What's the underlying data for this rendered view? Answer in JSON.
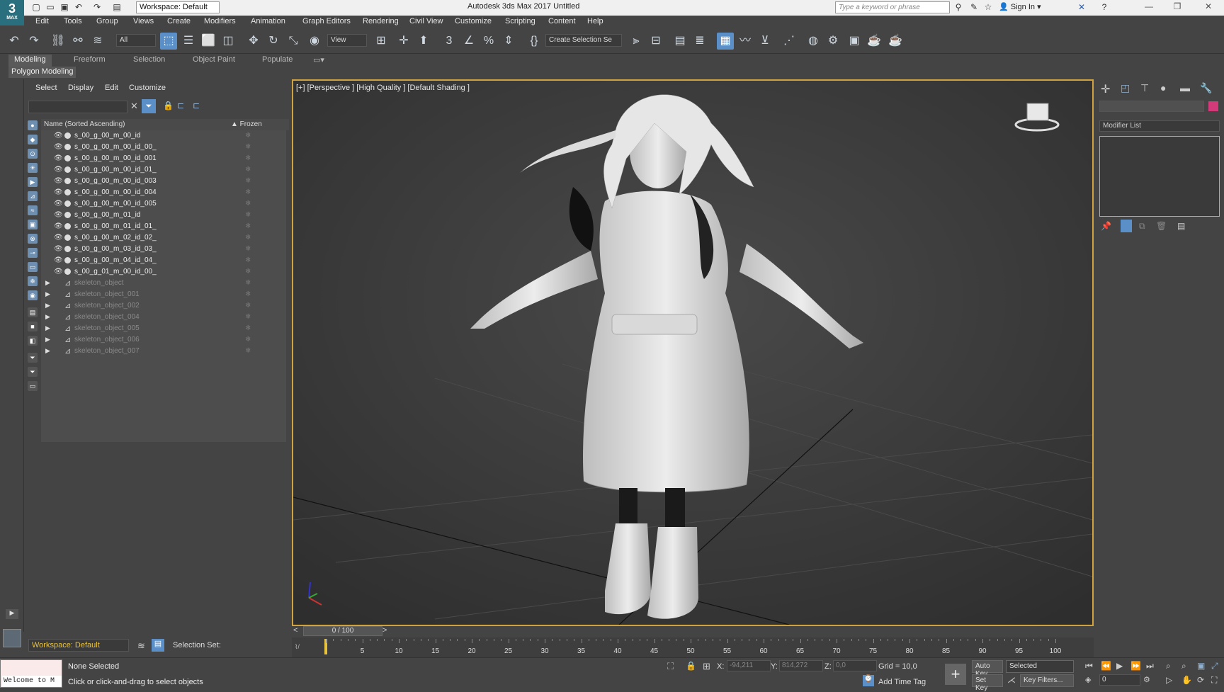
{
  "titlebar": {
    "logo_text": "3",
    "logo_sub": "MAX",
    "workspace": "Workspace: Default",
    "app_title": "Autodesk 3ds Max 2017     Untitled",
    "search_placeholder": "Type a keyword or phrase",
    "signin": "Sign In"
  },
  "menu": [
    "Edit",
    "Tools",
    "Group",
    "Views",
    "Create",
    "Modifiers",
    "Animation",
    "Graph Editors",
    "Rendering",
    "Civil View",
    "Customize",
    "Scripting",
    "Content",
    "Help"
  ],
  "toolbar": {
    "filter_value": "All",
    "refcoord_value": "View",
    "selection_set_value": "Create Selection Se"
  },
  "ribbon": {
    "tabs": [
      "Modeling",
      "Freeform",
      "Selection",
      "Object Paint",
      "Populate"
    ],
    "panel_label": "Polygon Modeling"
  },
  "explorer": {
    "menu": [
      "Select",
      "Display",
      "Edit",
      "Customize"
    ],
    "col_name": "Name (Sorted Ascending)",
    "col_frozen": "▲ Frozen",
    "objects": [
      "s_00_g_00_m_00_id",
      "s_00_g_00_m_00_id_00_",
      "s_00_g_00_m_00_id_001",
      "s_00_g_00_m_00_id_01_",
      "s_00_g_00_m_00_id_003",
      "s_00_g_00_m_00_id_004",
      "s_00_g_00_m_00_id_005",
      "s_00_g_00_m_01_id",
      "s_00_g_00_m_01_id_01_",
      "s_00_g_00_m_02_id_02_",
      "s_00_g_00_m_03_id_03_",
      "s_00_g_00_m_04_id_04_",
      "s_00_g_01_m_00_id_00_"
    ],
    "skeletons": [
      "skeleton_object",
      "skeleton_object_001",
      "skeleton_object_002",
      "skeleton_object_004",
      "skeleton_object_005",
      "skeleton_object_006",
      "skeleton_object_007"
    ]
  },
  "viewport": {
    "label": "[+] [Perspective ] [High Quality ] [Default Shading ]"
  },
  "cmdpanel": {
    "modifier_list": "Modifier List"
  },
  "timeline": {
    "slider": "0 / 100",
    "ticks": [
      "5",
      "10",
      "15",
      "20",
      "25",
      "30",
      "35",
      "40",
      "45",
      "50",
      "55",
      "60",
      "65",
      "70",
      "75",
      "80",
      "85",
      "90",
      "95",
      "100"
    ]
  },
  "bottom": {
    "workspace": "Workspace: Default",
    "selection_set": "Selection Set:",
    "welcome": "Welcome to M",
    "status1": "None Selected",
    "status2": "Click or click-and-drag to select objects",
    "x_label": "X:",
    "x_value": "-94,211",
    "y_label": "Y:",
    "y_value": "814,272",
    "z_label": "Z:",
    "z_value": "0,0",
    "grid": "Grid = 10,0",
    "add_time_tag": "Add Time Tag",
    "auto_key": "Auto Key",
    "selected": "Selected",
    "set_key": "Set Key",
    "key_filters": "Key Filters...",
    "frame": "0"
  },
  "colors": {
    "viewport_border": "#d0a33e",
    "selection_blue": "#5b8fc7",
    "swatch": "#d23a7a",
    "workspace_text": "#e8c23a"
  }
}
